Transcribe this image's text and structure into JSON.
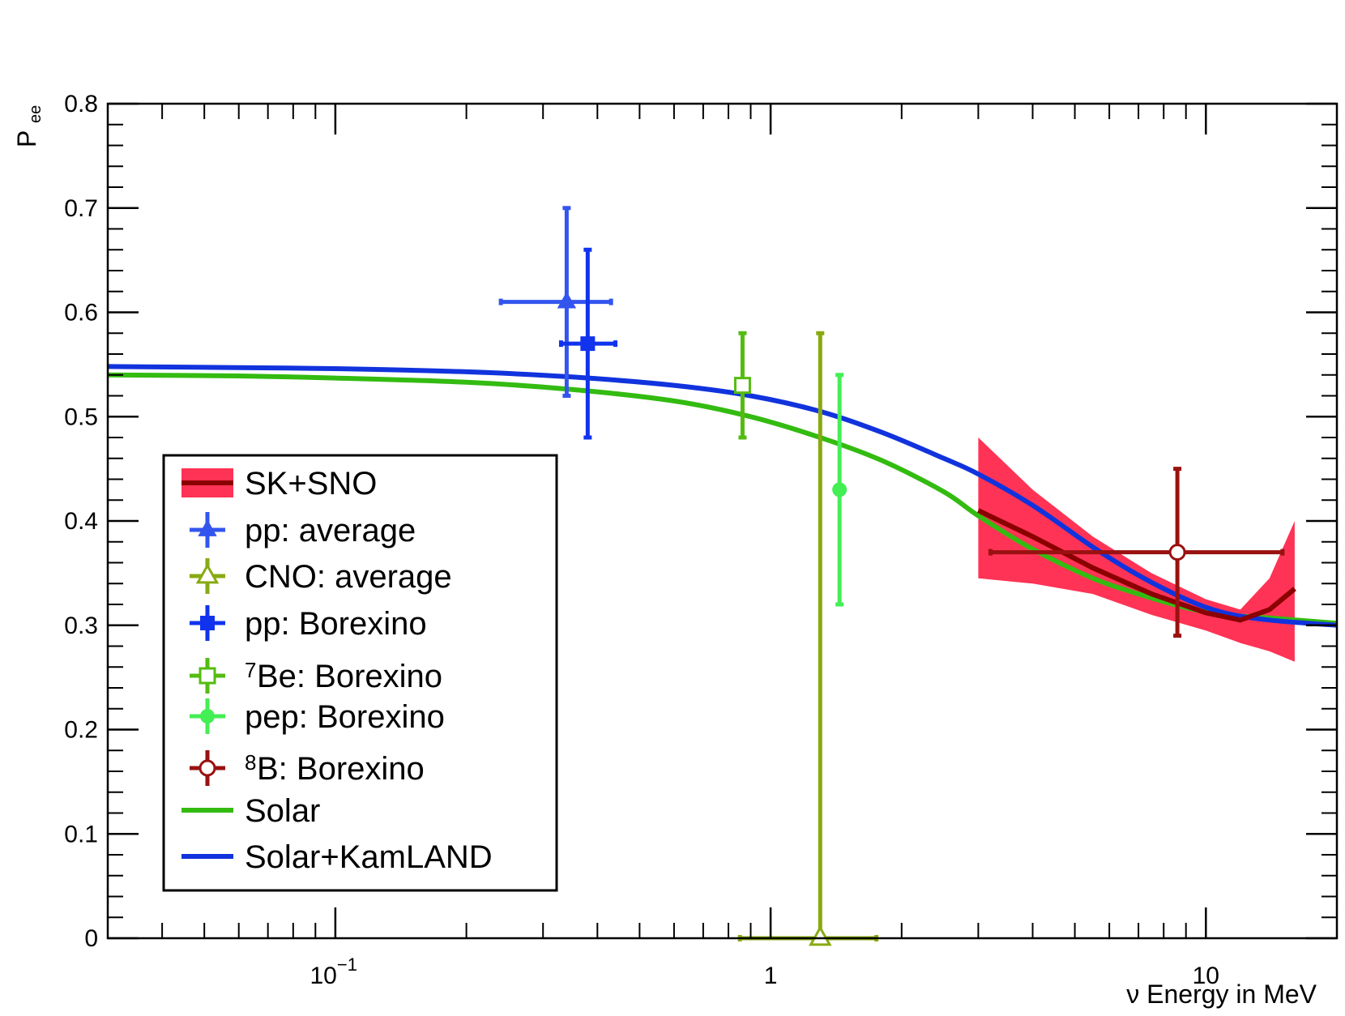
{
  "chart_data": {
    "type": "scatter",
    "xscale": "log",
    "xlim": [
      0.03,
      20
    ],
    "ylim": [
      0,
      0.8
    ],
    "grid": false,
    "xlabel": "ν Energy in MeV",
    "ylabel_main": "P",
    "ylabel_sub": "ee",
    "yticks": [
      {
        "value": 0,
        "label": "0"
      },
      {
        "value": 0.1,
        "label": "0.1"
      },
      {
        "value": 0.2,
        "label": "0.2"
      },
      {
        "value": 0.3,
        "label": "0.3"
      },
      {
        "value": 0.4,
        "label": "0.4"
      },
      {
        "value": 0.5,
        "label": "0.5"
      },
      {
        "value": 0.6,
        "label": "0.6"
      },
      {
        "value": 0.7,
        "label": "0.7"
      },
      {
        "value": 0.8,
        "label": "0.8"
      }
    ],
    "xticks": [
      {
        "value": 0.1,
        "base": "10",
        "exp": "−1"
      },
      {
        "value": 1,
        "base": "1",
        "exp": ""
      },
      {
        "value": 10,
        "base": "10",
        "exp": ""
      }
    ],
    "legend_position": "lower-left",
    "band": {
      "name": "SK+SNO",
      "fill_color": "#ff3355",
      "line_color": "#8b0000",
      "points": [
        {
          "x": 3.0,
          "y": 0.41,
          "lo": 0.345,
          "hi": 0.48
        },
        {
          "x": 4.0,
          "y": 0.385,
          "lo": 0.34,
          "hi": 0.43
        },
        {
          "x": 5.5,
          "y": 0.355,
          "lo": 0.33,
          "hi": 0.385
        },
        {
          "x": 7.5,
          "y": 0.33,
          "lo": 0.31,
          "hi": 0.35
        },
        {
          "x": 10.0,
          "y": 0.312,
          "lo": 0.295,
          "hi": 0.325
        },
        {
          "x": 12.0,
          "y": 0.305,
          "lo": 0.283,
          "hi": 0.315
        },
        {
          "x": 14.0,
          "y": 0.315,
          "lo": 0.275,
          "hi": 0.345
        },
        {
          "x": 16.0,
          "y": 0.335,
          "lo": 0.265,
          "hi": 0.4
        }
      ]
    },
    "curves": [
      {
        "name": "Solar",
        "color": "#33bb11",
        "x": [
          0.03,
          0.06,
          0.1,
          0.2,
          0.35,
          0.6,
          0.9,
          1.3,
          1.8,
          2.5,
          3.0,
          4.0,
          5.5,
          7.0,
          9.0,
          11.0,
          14.0,
          20.0
        ],
        "y": [
          0.54,
          0.539,
          0.537,
          0.533,
          0.526,
          0.515,
          0.5,
          0.48,
          0.458,
          0.428,
          0.405,
          0.373,
          0.345,
          0.33,
          0.317,
          0.31,
          0.307,
          0.302
        ]
      },
      {
        "name": "Solar+KamLAND",
        "color": "#1133dd",
        "x": [
          0.03,
          0.06,
          0.1,
          0.2,
          0.35,
          0.6,
          0.9,
          1.3,
          1.8,
          2.5,
          3.0,
          4.0,
          5.5,
          7.0,
          9.0,
          11.0,
          14.0,
          20.0
        ],
        "y": [
          0.548,
          0.547,
          0.546,
          0.543,
          0.538,
          0.53,
          0.52,
          0.505,
          0.485,
          0.46,
          0.445,
          0.415,
          0.375,
          0.348,
          0.325,
          0.312,
          0.305,
          0.3
        ]
      }
    ],
    "series": [
      {
        "name": "pp: average",
        "label_sup": "",
        "color": "#3355ee",
        "marker": "triangle",
        "filled": true,
        "x": 0.34,
        "y": 0.61,
        "xlo": 0.24,
        "xhi": 0.43,
        "ylo": 0.52,
        "yhi": 0.7
      },
      {
        "name": "CNO: average",
        "label_sup": "",
        "color": "#88aa11",
        "marker": "triangle",
        "filled": false,
        "x": 1.3,
        "y": 0.0,
        "xlo": 0.85,
        "xhi": 1.75,
        "ylo": -0.005,
        "yhi": 0.58
      },
      {
        "name": "pp: Borexino",
        "label_sup": "",
        "color": "#1133ee",
        "marker": "square",
        "filled": true,
        "x": 0.38,
        "y": 0.57,
        "xlo": 0.33,
        "xhi": 0.44,
        "ylo": 0.48,
        "yhi": 0.66
      },
      {
        "name": "Be: Borexino",
        "label_sup": "7",
        "color": "#55bb11",
        "marker": "square",
        "filled": false,
        "x": 0.862,
        "y": 0.53,
        "xlo": 0.862,
        "xhi": 0.862,
        "ylo": 0.48,
        "yhi": 0.58
      },
      {
        "name": "pep: Borexino",
        "label_sup": "",
        "color": "#44ee55",
        "marker": "circle",
        "filled": true,
        "x": 1.44,
        "y": 0.43,
        "xlo": 1.44,
        "xhi": 1.44,
        "ylo": 0.32,
        "yhi": 0.54
      },
      {
        "name": "B: Borexino",
        "label_sup": "8",
        "color": "#991111",
        "marker": "circle",
        "filled": false,
        "x": 8.6,
        "y": 0.37,
        "xlo": 3.2,
        "xhi": 15.0,
        "ylo": 0.29,
        "yhi": 0.45
      }
    ],
    "legend": [
      {
        "label": "SK+SNO",
        "sup": "",
        "kind": "band"
      },
      {
        "label": "pp: average",
        "sup": "",
        "kind": "series",
        "ref": 0
      },
      {
        "label": "CNO: average",
        "sup": "",
        "kind": "series",
        "ref": 1
      },
      {
        "label": "pp: Borexino",
        "sup": "",
        "kind": "series",
        "ref": 2
      },
      {
        "label": "Be: Borexino",
        "sup": "7",
        "kind": "series",
        "ref": 3
      },
      {
        "label": "pep: Borexino",
        "sup": "",
        "kind": "series",
        "ref": 4
      },
      {
        "label": "B: Borexino",
        "sup": "8",
        "kind": "series",
        "ref": 5
      },
      {
        "label": "Solar",
        "sup": "",
        "kind": "curve",
        "ref": 0
      },
      {
        "label": "Solar+KamLAND",
        "sup": "",
        "kind": "curve",
        "ref": 1
      }
    ]
  }
}
